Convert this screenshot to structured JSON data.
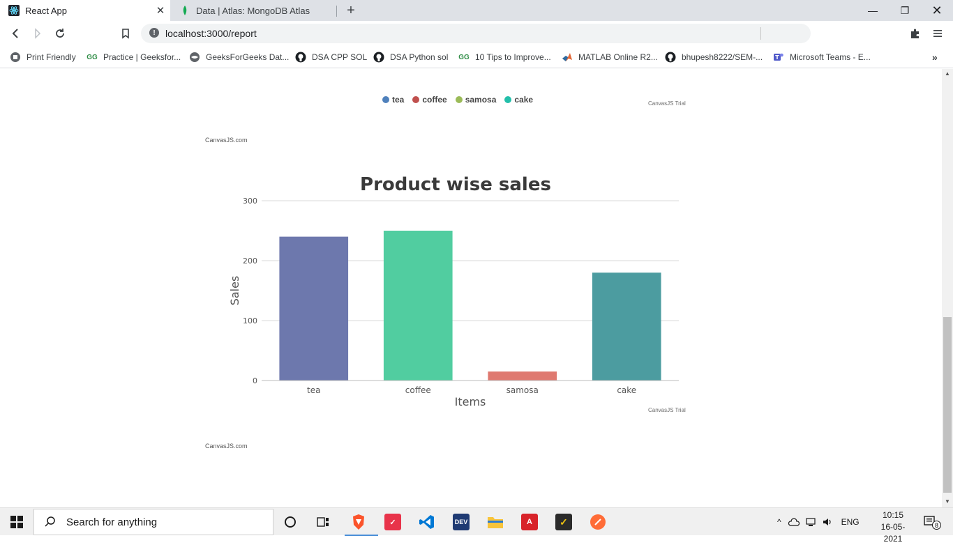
{
  "browser": {
    "tabs": [
      {
        "title": "React App",
        "active": true
      },
      {
        "title": "Data | Atlas: MongoDB Atlas",
        "active": false
      }
    ],
    "url": "localhost:3000/report",
    "bookmarks": [
      {
        "label": "Print Friendly",
        "icon": "print-friendly-icon"
      },
      {
        "label": "Practice | Geeksfor...",
        "icon": "geeksforgeeks-icon"
      },
      {
        "label": "GeeksForGeeks Dat...",
        "icon": "globe-icon"
      },
      {
        "label": "DSA CPP SOL",
        "icon": "github-icon"
      },
      {
        "label": "DSA Python sol",
        "icon": "github-icon"
      },
      {
        "label": "10 Tips to Improve...",
        "icon": "geeksforgeeks-icon"
      },
      {
        "label": "MATLAB Online R2...",
        "icon": "matlab-icon"
      },
      {
        "label": "bhupesh8222/SEM-...",
        "icon": "github-icon"
      },
      {
        "label": "Microsoft Teams - E...",
        "icon": "teams-icon"
      }
    ]
  },
  "page": {
    "pie_legend": [
      {
        "label": "tea",
        "color": "#4f81bc"
      },
      {
        "label": "coffee",
        "color": "#c0504e"
      },
      {
        "label": "samosa",
        "color": "#9bbb58"
      },
      {
        "label": "cake",
        "color": "#23bfaa"
      }
    ],
    "trial_label_1": "CanvasJS Trial",
    "credit_1": "CanvasJS.com",
    "trial_label_2": "CanvasJS Trial",
    "credit_2": "CanvasJS.com"
  },
  "chart_data": {
    "type": "bar",
    "title": "Product wise sales",
    "xlabel": "Items",
    "ylabel": "Sales",
    "categories": [
      "tea",
      "coffee",
      "samosa",
      "cake"
    ],
    "values": [
      240,
      250,
      15,
      180
    ],
    "colors": [
      "#6d78ad",
      "#51cda0",
      "#df7970",
      "#4c9ca0"
    ],
    "ylim": [
      0,
      300
    ],
    "yticks": [
      "0",
      "100",
      "200",
      "300"
    ],
    "grid": true
  },
  "taskbar": {
    "search_placeholder": "Search for anything",
    "language": "ENG",
    "time": "10:15",
    "date": "16-05-2021",
    "notification_count": "8"
  }
}
